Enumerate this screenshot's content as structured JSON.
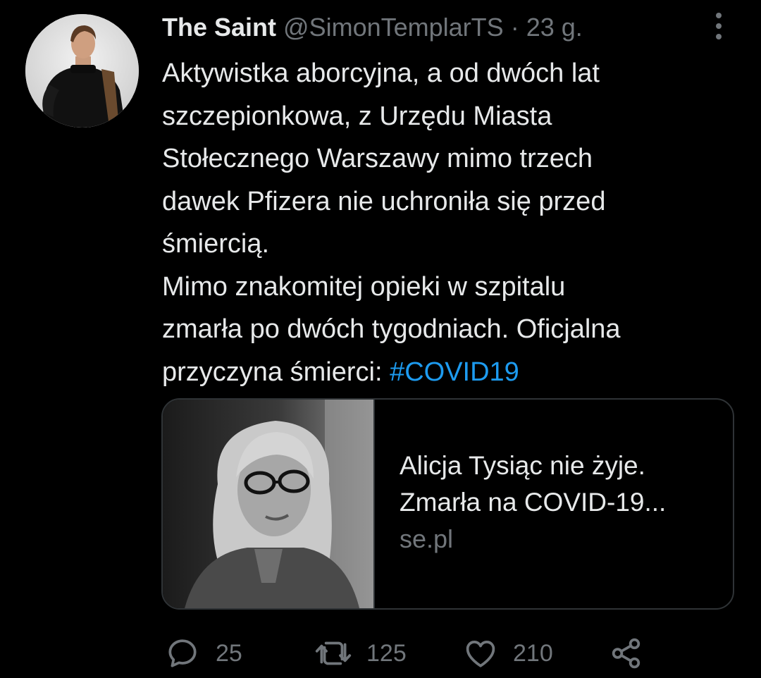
{
  "tweet": {
    "display_name": "The Saint",
    "handle": "@SimonTemplarTS",
    "separator": "·",
    "time": "23 g.",
    "text_parts": [
      "Aktywistka aborcyjna, a od dwóch lat\nszczepionkowa, z Urzędu Miasta\nStołecznego Warszawy mimo trzech\ndawek Pfizera nie uchroniła się przed\nśmiercią.\nMimo znakomitej opieki w szpitalu\nzmarła po dwóch tygodniach. Oficjalna\nprzyczyna śmierci: "
    ],
    "hashtag": "#COVID19"
  },
  "card": {
    "title_line1": "Alicja Tysiąc nie żyje.",
    "title_line2": "Zmarła na COVID-19...",
    "domain": "se.pl"
  },
  "actions": {
    "reply_count": "25",
    "retweet_count": "125",
    "like_count": "210"
  },
  "icons": {
    "more": "more-vertical-icon",
    "reply": "reply-icon",
    "retweet": "retweet-icon",
    "like": "heart-icon",
    "share": "share-icon"
  },
  "colors": {
    "background": "#000000",
    "text": "#e7e9ea",
    "secondary": "#71767b",
    "link": "#1d9bf0",
    "border": "#2f3336"
  }
}
